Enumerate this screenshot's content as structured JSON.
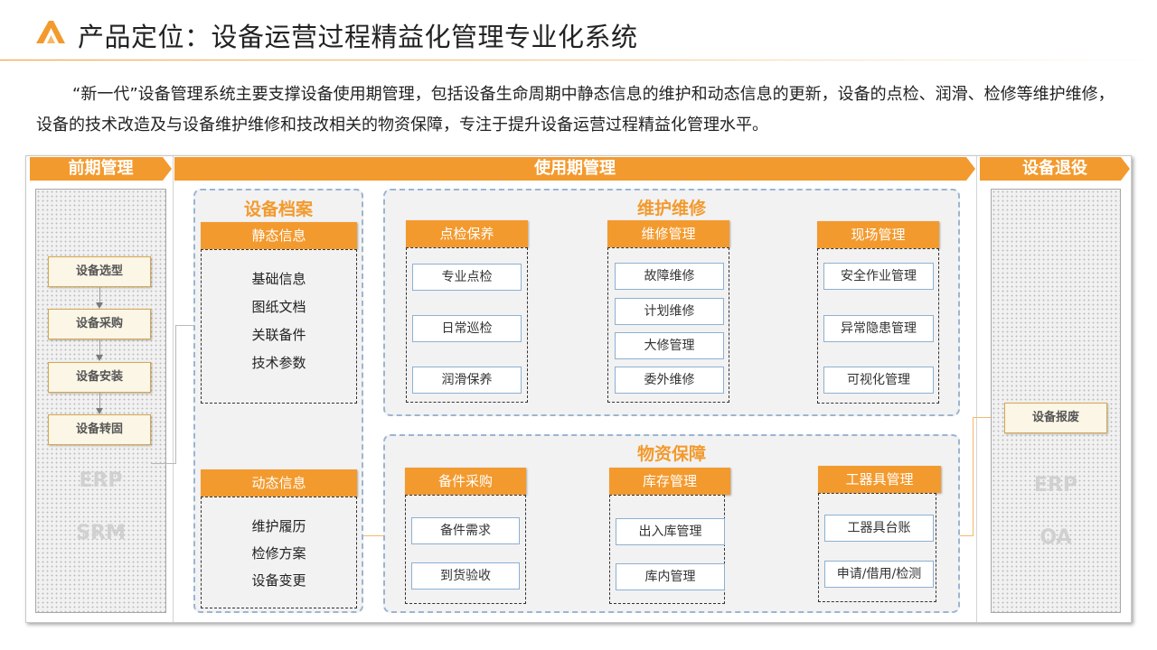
{
  "header": {
    "title": "产品定位：设备运营过程精益化管理专业化系统",
    "intro": "“新一代”设备管理系统主要支撑设备使用期管理，包括设备生命周期中静态信息的维护和动态信息的更新，设备的点检、润滑、检修等维护维修，设备的技术改造及与设备维护维修和技改相关的物资保障，专注于提升设备运营过程精益化管理水平。"
  },
  "colors": {
    "accent": "#f39a2e",
    "group_border": "#9bb5d2",
    "item_border": "#8db0d2"
  },
  "phases": {
    "early": "前期管理",
    "use": "使用期管理",
    "retire": "设备退役"
  },
  "early": {
    "steps": [
      "设备选型",
      "设备采购",
      "设备安装",
      "设备转固"
    ],
    "systems": [
      "ERP",
      "SRM"
    ]
  },
  "archive": {
    "title": "设备档案",
    "static": {
      "head": "静态信息",
      "items": [
        "基础信息",
        "图纸文档",
        "关联备件",
        "技术参数"
      ]
    },
    "dynamic": {
      "head": "动态信息",
      "items": [
        "维护履历",
        "检修方案",
        "设备变更"
      ]
    }
  },
  "maintenance": {
    "title": "维护维修",
    "cats": [
      {
        "head": "点检保养",
        "items": [
          "专业点检",
          "日常巡检",
          "润滑保养"
        ]
      },
      {
        "head": "维修管理",
        "items": [
          "故障维修",
          "计划维修",
          "大修管理",
          "委外维修"
        ]
      },
      {
        "head": "现场管理",
        "items": [
          "安全作业管理",
          "异常隐患管理",
          "可视化管理"
        ]
      }
    ]
  },
  "materials": {
    "title": "物资保障",
    "cats": [
      {
        "head": "备件采购",
        "items": [
          "备件需求",
          "到货验收"
        ]
      },
      {
        "head": "库存管理",
        "items": [
          "出入库管理",
          "库内管理"
        ]
      },
      {
        "head": "工器具管理",
        "items": [
          "工器具台账",
          "申请/借用/检测"
        ]
      }
    ]
  },
  "retire": {
    "step": "设备报废",
    "systems": [
      "ERP",
      "OA"
    ]
  }
}
